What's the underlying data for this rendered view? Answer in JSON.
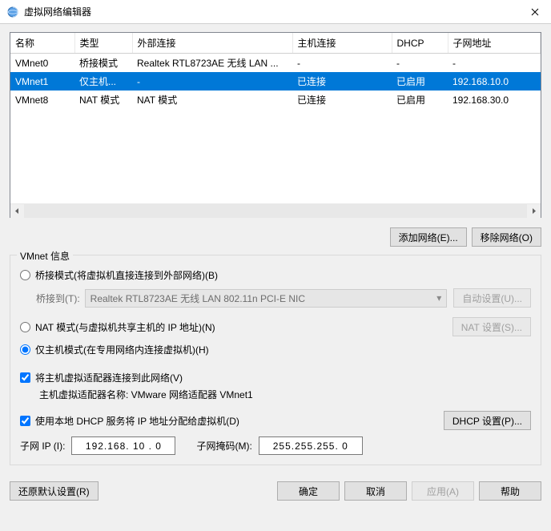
{
  "title": "虚拟网络编辑器",
  "columns": [
    "名称",
    "类型",
    "外部连接",
    "主机连接",
    "DHCP",
    "子网地址"
  ],
  "rows": [
    {
      "name": "VMnet0",
      "type": "桥接模式",
      "ext": "Realtek RTL8723AE 无线 LAN ...",
      "host": "-",
      "dhcp": "-",
      "subnet": "-"
    },
    {
      "name": "VMnet1",
      "type": "仅主机...",
      "ext": "-",
      "host": "已连接",
      "dhcp": "已启用",
      "subnet": "192.168.10.0"
    },
    {
      "name": "VMnet8",
      "type": "NAT 模式",
      "ext": "NAT 模式",
      "host": "已连接",
      "dhcp": "已启用",
      "subnet": "192.168.30.0"
    }
  ],
  "buttons": {
    "add_network": "添加网络(E)...",
    "remove_network": "移除网络(O)",
    "auto_settings": "自动设置(U)...",
    "nat_settings": "NAT 设置(S)...",
    "dhcp_settings": "DHCP 设置(P)...",
    "restore": "还原默认设置(R)",
    "ok": "确定",
    "cancel": "取消",
    "apply": "应用(A)",
    "help": "帮助"
  },
  "group": {
    "legend": "VMnet 信息",
    "bridge_label": "桥接模式(将虚拟机直接连接到外部网络)(B)",
    "bridge_to_label": "桥接到(T):",
    "bridge_to_value": "Realtek RTL8723AE 无线 LAN 802.11n PCI-E NIC",
    "nat_label": "NAT 模式(与虚拟机共享主机的 IP 地址)(N)",
    "hostonly_label": "仅主机模式(在专用网络内连接虚拟机)(H)",
    "connect_host_label": "将主机虚拟适配器连接到此网络(V)",
    "host_adapter_label": "主机虚拟适配器名称: VMware 网络适配器 VMnet1",
    "dhcp_label": "使用本地 DHCP 服务将 IP 地址分配给虚拟机(D)",
    "subnet_ip_label": "子网 IP (I):",
    "subnet_ip_value": "192.168. 10 . 0",
    "subnet_mask_label": "子网掩码(M):",
    "subnet_mask_value": "255.255.255. 0"
  }
}
